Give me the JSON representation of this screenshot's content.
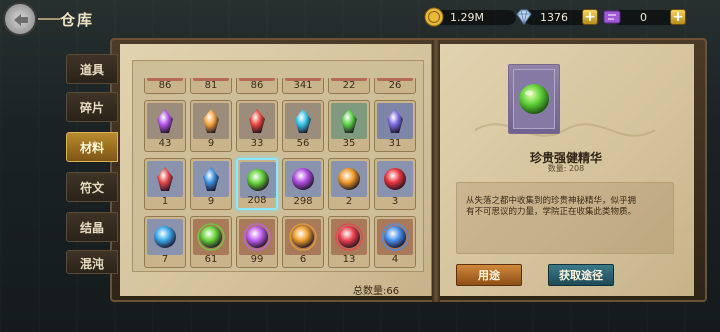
{
  "header": {
    "title": "仓库",
    "resources": [
      {
        "icon": "coin-icon",
        "value": "1.29M"
      },
      {
        "icon": "diamond-icon",
        "value": "1376"
      },
      {
        "icon": "ticket-icon",
        "value": "0"
      }
    ]
  },
  "tabs": [
    {
      "label": "道具",
      "active": false
    },
    {
      "label": "碎片",
      "active": false
    },
    {
      "label": "材料",
      "active": true
    },
    {
      "label": "符文",
      "active": false
    },
    {
      "label": "结晶",
      "active": false
    },
    {
      "label": "混沌",
      "active": false
    }
  ],
  "inventory": {
    "rows": [
      [
        {
          "count": "86",
          "gem": "red-crystal-icon",
          "bg": "#b56a5a",
          "color": "#e0554a"
        },
        {
          "count": "81",
          "gem": "red-crystal-icon",
          "bg": "#b56a5a",
          "color": "#e0554a"
        },
        {
          "count": "86",
          "gem": "red-crystal-icon",
          "bg": "#b56a5a",
          "color": "#e0554a"
        },
        {
          "count": "341",
          "gem": "red-crystal-icon",
          "bg": "#b56a5a",
          "color": "#e0554a"
        },
        {
          "count": "22",
          "gem": "red-crystal-icon",
          "bg": "#b56a5a",
          "color": "#e0554a"
        },
        {
          "count": "26",
          "gem": "red-crystal-icon",
          "bg": "#b56a5a",
          "color": "#e0554a"
        }
      ],
      [
        {
          "count": "43",
          "gem": "purple-shard-icon",
          "bg": "#9b8c7b",
          "color": "#b455e6"
        },
        {
          "count": "9",
          "gem": "orange-shard-icon",
          "bg": "#9b8c7b",
          "color": "#f2a23a"
        },
        {
          "count": "33",
          "gem": "red-shard-icon",
          "bg": "#9b8c7b",
          "color": "#e8483d"
        },
        {
          "count": "56",
          "gem": "cyan-shard-icon",
          "bg": "#9b8c7b",
          "color": "#37c4e8"
        },
        {
          "count": "35",
          "gem": "green-shard-icon",
          "bg": "#7f9a7f",
          "color": "#5bd147"
        },
        {
          "count": "31",
          "gem": "violet-shard-icon",
          "bg": "#7d86a6",
          "color": "#7b6ae0"
        }
      ],
      [
        {
          "count": "1",
          "gem": "red-crystal-icon",
          "bg": "#8a93ad",
          "color": "#e24a4a"
        },
        {
          "count": "9",
          "gem": "blue-crystal-icon",
          "bg": "#8a93ad",
          "color": "#3a8fe0"
        },
        {
          "count": "208",
          "gem": "green-orb-icon",
          "bg": "#8a93ad",
          "color": "#62d23a",
          "selected": true
        },
        {
          "count": "298",
          "gem": "purple-orb-icon",
          "bg": "#8a93ad",
          "color": "#b04ee0"
        },
        {
          "count": "2",
          "gem": "orange-orb-icon",
          "bg": "#8a93ad",
          "color": "#f09a2a"
        },
        {
          "count": "3",
          "gem": "red-orb-icon",
          "bg": "#8a93ad",
          "color": "#e8363d"
        }
      ],
      [
        {
          "count": "7",
          "gem": "blue-orb-icon",
          "bg": "#8a93ad",
          "color": "#3aa8e8"
        },
        {
          "count": "61",
          "gem": "green-aura-orb-icon",
          "bg": "#a87a5a",
          "color": "#6ad43a"
        },
        {
          "count": "99",
          "gem": "purple-aura-orb-icon",
          "bg": "#a87a5a",
          "color": "#c060f0"
        },
        {
          "count": "6",
          "gem": "orange-aura-orb-icon",
          "bg": "#a87a5a",
          "color": "#f0a030"
        },
        {
          "count": "13",
          "gem": "red-aura-orb-icon",
          "bg": "#a87a5a",
          "color": "#f04050"
        },
        {
          "count": "4",
          "gem": "blue-aura-orb-icon",
          "bg": "#a87a5a",
          "color": "#4a90f0"
        }
      ]
    ],
    "total_label": "总数量:66"
  },
  "detail": {
    "name": "珍贵强健精华",
    "count_label": "数量: 208",
    "description": "从失落之都中收集到的珍贵神秘精华，似乎拥有不可思议的力量，学院正在收集此类物质。",
    "use_label": "用途",
    "get_label": "获取途径"
  }
}
